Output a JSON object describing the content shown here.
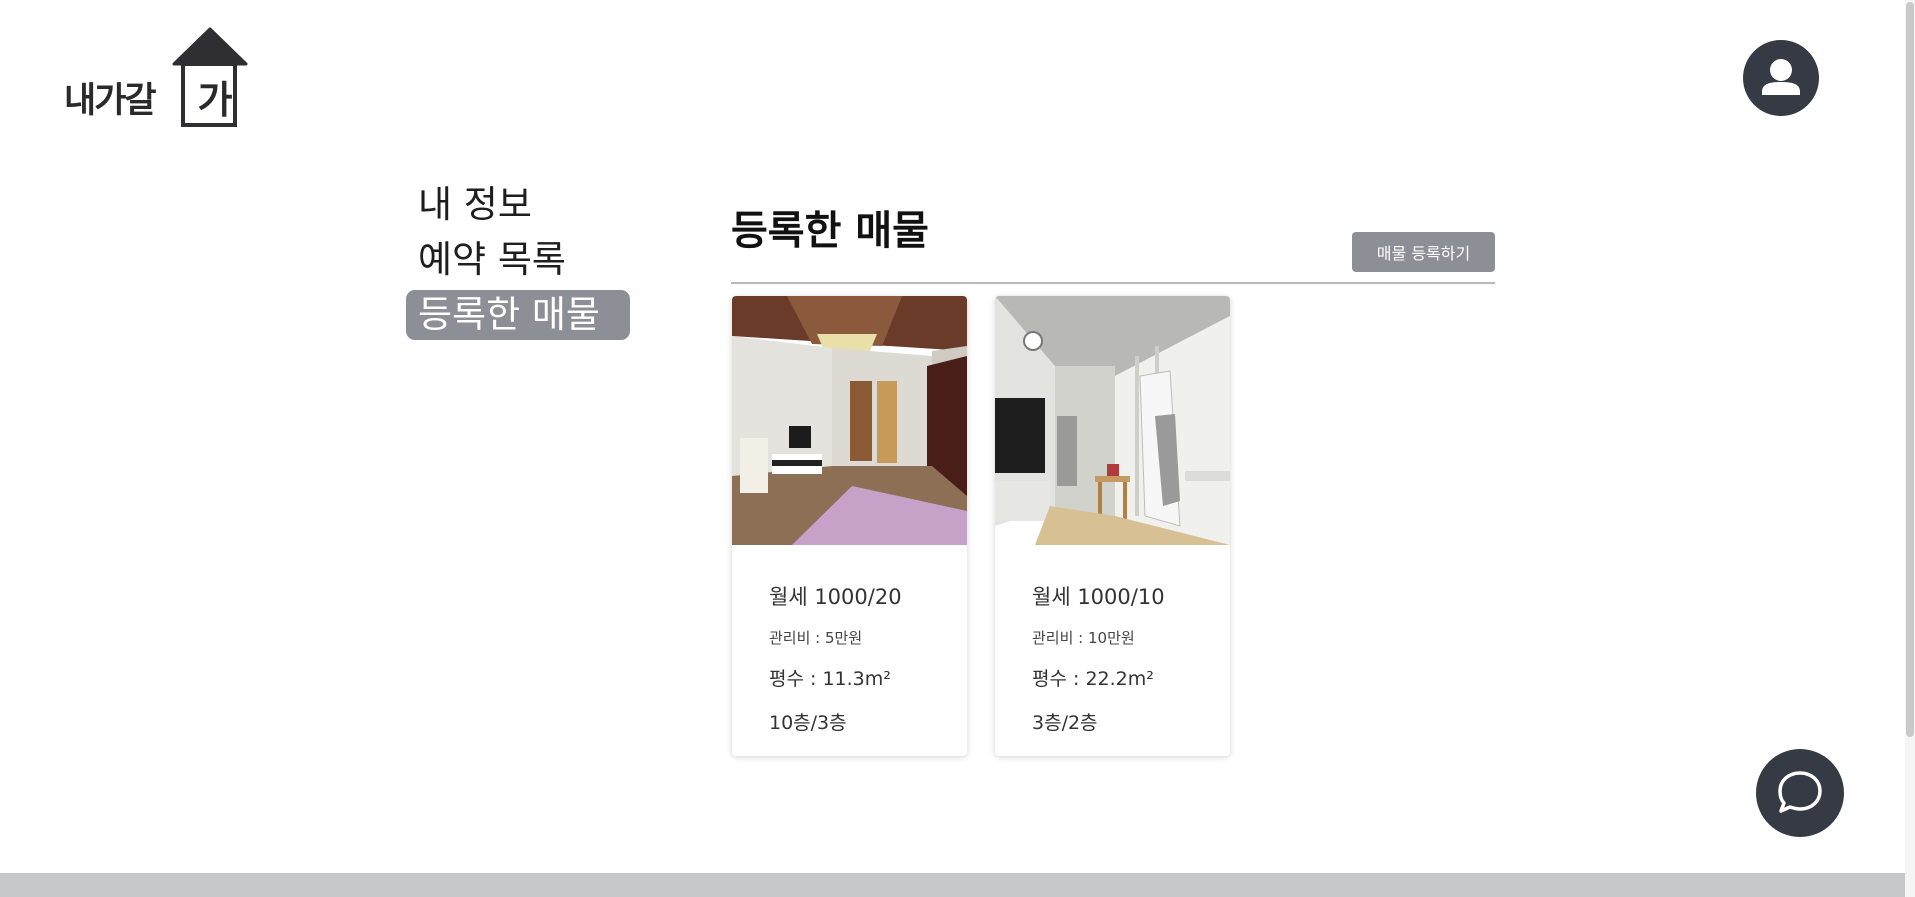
{
  "header": {
    "logo": {
      "text": "내가갈",
      "house_char": "가",
      "icon": "house-logo-icon"
    },
    "avatar_icon": "user-icon"
  },
  "sidebar": {
    "items": [
      {
        "label": "내 정보",
        "active": false
      },
      {
        "label": "예약 목록",
        "active": false
      },
      {
        "label": "등록한 매물",
        "active": true
      }
    ]
  },
  "main": {
    "title": "등록한 매물",
    "register_button": "매물 등록하기",
    "listings": [
      {
        "price": "월세 1000/20",
        "fee": "관리비 : 5만원",
        "area": "평수 : 11.3m²",
        "floor": "10층/3층",
        "photo": "room-photo-1"
      },
      {
        "price": "월세 1000/10",
        "fee": "관리비 : 10만원",
        "area": "평수 : 22.2m²",
        "floor": "3층/2층",
        "photo": "room-photo-2"
      }
    ]
  },
  "chat_icon": "chat-bubble-icon",
  "colors": {
    "dark": "#363a44",
    "accent_gray": "#8c8f96",
    "divider": "#b8b8bd",
    "footer": "#c6c7cb"
  }
}
